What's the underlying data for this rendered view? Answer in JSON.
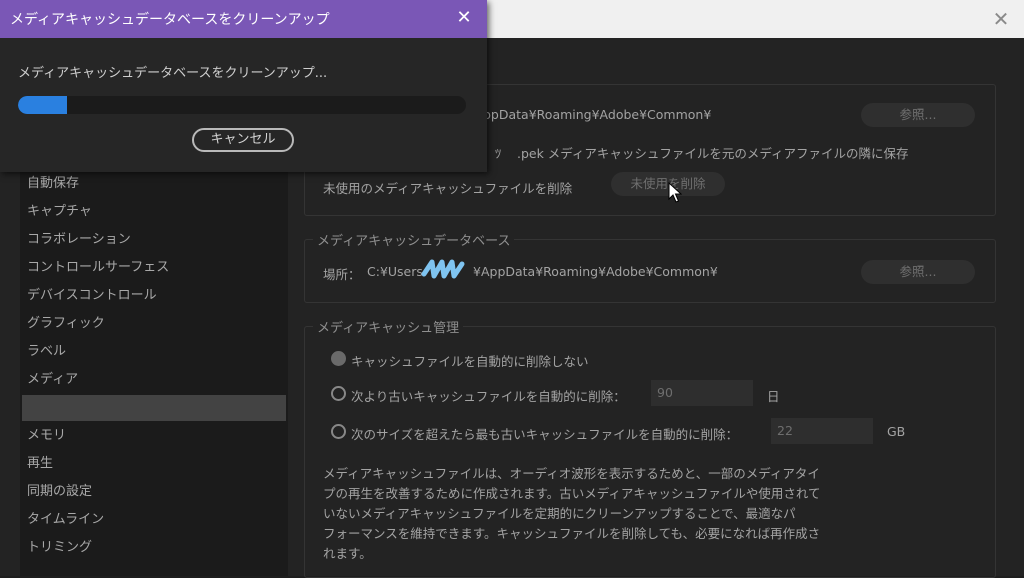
{
  "modal": {
    "title": "メディアキャッシュデータベースをクリーンアップ",
    "message": "メディアキャッシュデータベースをクリーンアップ...",
    "progress": 0.11,
    "cancel_label": "キャンセル",
    "accent_color": "#7a57b6",
    "progress_color": "#2a80e0"
  },
  "sidebar": {
    "items": [
      {
        "label": "自動保存"
      },
      {
        "label": "キャプチャ"
      },
      {
        "label": "コラボレーション"
      },
      {
        "label": "コントロールサーフェス"
      },
      {
        "label": "デバイスコントロール"
      },
      {
        "label": "グラフィック"
      },
      {
        "label": "ラベル"
      },
      {
        "label": "メディア"
      },
      {
        "label": ""
      },
      {
        "label": "メモリ"
      },
      {
        "label": "再生"
      },
      {
        "label": "同期の設定"
      },
      {
        "label": "タイムライン"
      },
      {
        "label": "トリミング"
      }
    ]
  },
  "cache_files": {
    "location_path": "ppData¥Roaming¥Adobe¥Common¥",
    "browse_label": "参照...",
    "save_option_prefix": "ﾂ",
    "save_option_text": ".pek メディアキャッシュファイルを元のメディアファイルの隣に保存",
    "remove_unused_label": "未使用のメディアキャッシュファイルを削除",
    "remove_unused_button": "未使用を削除"
  },
  "database": {
    "title": "メディアキャッシュデータベース",
    "location_label": "場所：",
    "location_path_start": "C:¥Users",
    "location_path_end": "¥AppData¥Roaming¥Adobe¥Common¥",
    "browse_label": "参照..."
  },
  "management": {
    "title": "メディアキャッシュ管理",
    "option_none": "キャッシュファイルを自動的に削除しない",
    "option_age": "次より古いキャッシュファイルを自動的に削除：",
    "age_value": "90",
    "age_unit": "日",
    "option_size": "次のサイズを超えたら最も古いキャッシュファイルを自動的に削除：",
    "size_value": "22",
    "size_unit": "GB",
    "description": [
      "メディアキャッシュファイルは、オーディオ波形を表示するためと、一部のメディアタイ",
      "プの再生を改善するために作成されます。古いメディアキャッシュファイルや使用されて",
      "いないメディアキャッシュファイルを定期的にクリーンアップすることで、最適なパ",
      "フォーマンスを維持できます。キャッシュファイルを削除しても、必要になれば再作成さ",
      "れます。"
    ]
  },
  "icons": {
    "modal_close": "close-icon",
    "pref_close": "close-icon",
    "cursor": "mouse-cursor-icon"
  }
}
